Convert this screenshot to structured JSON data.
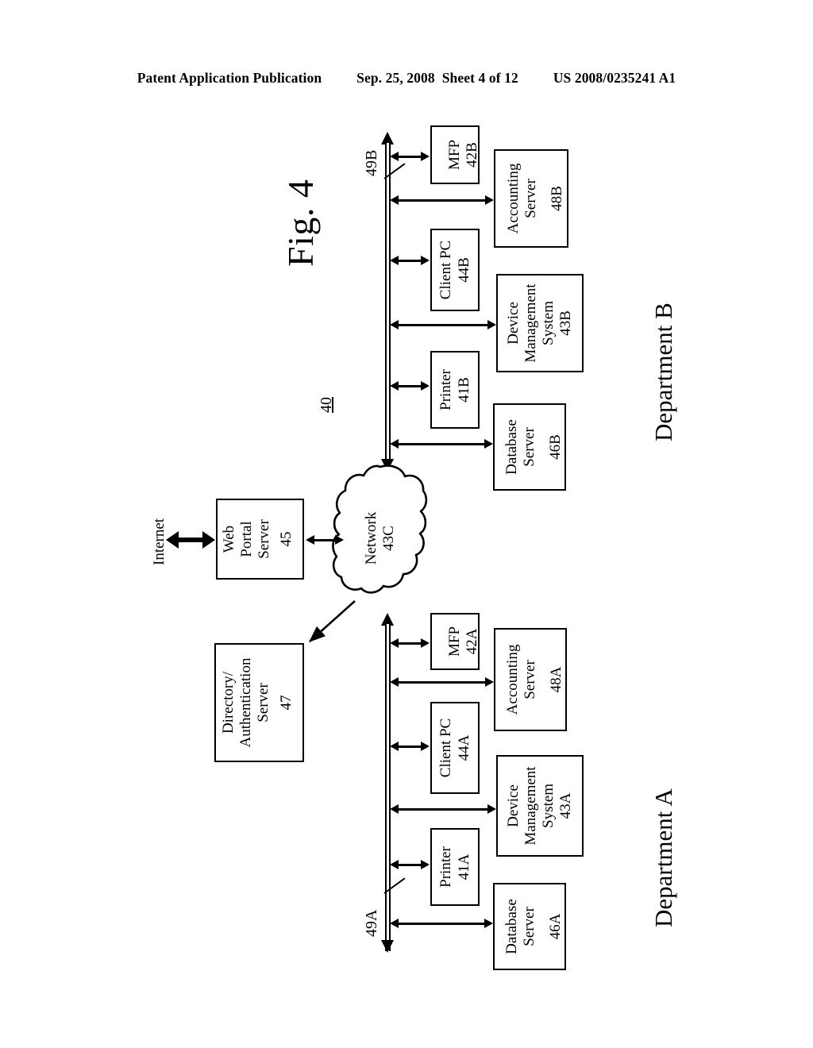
{
  "header": {
    "publication": "Patent Application Publication",
    "date": "Sep. 25, 2008",
    "sheet": "Sheet 4 of 12",
    "patent_number": "US 2008/0235241 A1"
  },
  "figure": {
    "title": "Fig. 4",
    "system_ref": "40",
    "internet_label": "Internet",
    "department_b_label": "Department B",
    "department_a_label": "Department A",
    "bus_b_ref": "49B",
    "bus_a_ref": "49A",
    "network": {
      "name": "Network",
      "ref": "43C",
      "label": "Network\n43C"
    },
    "shared_nodes": [
      {
        "id": "web-portal-server",
        "line1": "Web",
        "line2": "Portal",
        "line3": "Server",
        "ref": "45"
      },
      {
        "id": "directory-auth-server",
        "line1": "Directory/",
        "line2": "Authentication",
        "line3": "Server",
        "ref": "47"
      }
    ],
    "department_b_nodes": [
      {
        "id": "mfp-42b",
        "name": "MFP",
        "ref": "42B"
      },
      {
        "id": "accounting-server-48b",
        "name": "Accounting\nServer",
        "ref": "48B"
      },
      {
        "id": "client-pc-44b",
        "name": "Client PC",
        "ref": "44B"
      },
      {
        "id": "device-management-system-43b",
        "name": "Device\nManagement\nSystem",
        "ref": "43B"
      },
      {
        "id": "printer-41b",
        "name": "Printer",
        "ref": "41B"
      },
      {
        "id": "database-server-46b",
        "name": "Database\nServer",
        "ref": "46B"
      }
    ],
    "department_a_nodes": [
      {
        "id": "mfp-42a",
        "name": "MFP",
        "ref": "42A"
      },
      {
        "id": "accounting-server-48a",
        "name": "Accounting\nServer",
        "ref": "48A"
      },
      {
        "id": "client-pc-44a",
        "name": "Client PC",
        "ref": "44A"
      },
      {
        "id": "device-management-system-43a",
        "name": "Device\nManagement\nSystem",
        "ref": "43A"
      },
      {
        "id": "printer-41a",
        "name": "Printer",
        "ref": "41A"
      },
      {
        "id": "database-server-46a",
        "name": "Database\nServer",
        "ref": "46A"
      }
    ],
    "colors": {
      "ink": "#000000",
      "paper": "#ffffff"
    }
  }
}
